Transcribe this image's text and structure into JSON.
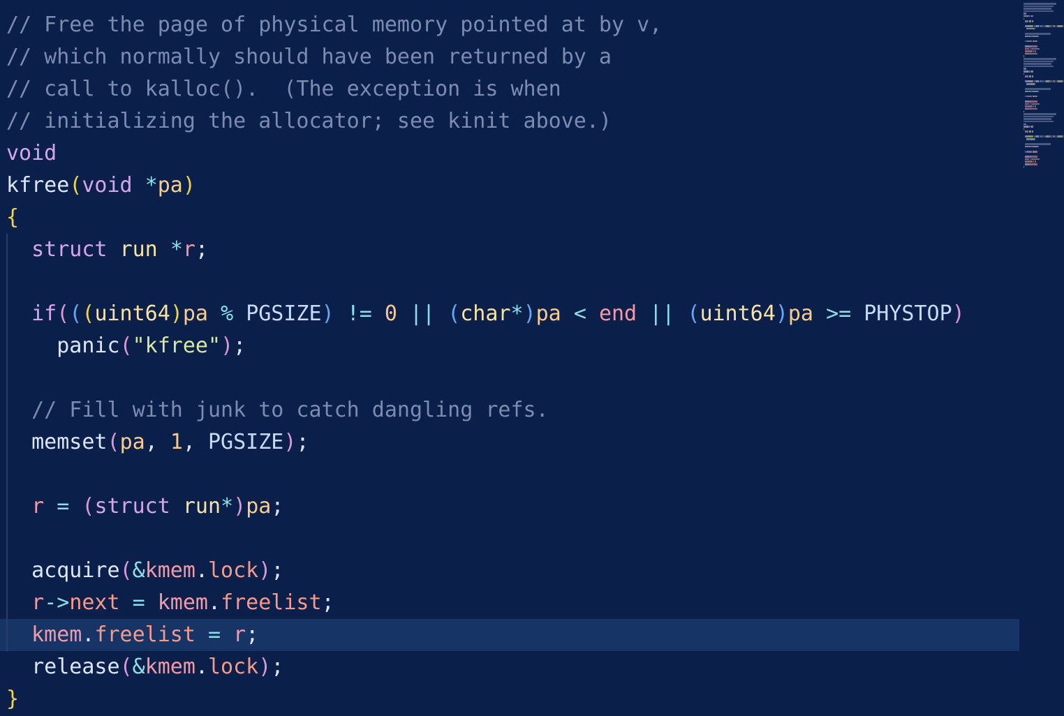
{
  "editor": {
    "language": "c",
    "colors": {
      "background": "#0b1f4b",
      "current_line": "#163466",
      "comment": "#7c8bb0",
      "keyword": "#d4a6ea",
      "string": "#d6e9a3",
      "number": "#f8c98a",
      "variable": "#f39aa8",
      "bracket": "#f3d349"
    },
    "current_line_index": 19,
    "lines": [
      {
        "tokens": [
          {
            "text": "// Free the page of physical memory pointed at by v,",
            "type": "comment"
          }
        ]
      },
      {
        "tokens": [
          {
            "text": "// which normally should have been returned by a",
            "type": "comment"
          }
        ]
      },
      {
        "tokens": [
          {
            "text": "// call to kalloc().  (The exception is when",
            "type": "comment"
          }
        ]
      },
      {
        "tokens": [
          {
            "text": "// initializing the allocator; see kinit above.)",
            "type": "comment"
          }
        ]
      },
      {
        "tokens": [
          {
            "text": "void",
            "type": "keyword"
          }
        ]
      },
      {
        "tokens": [
          {
            "text": "kfree",
            "type": "func"
          },
          {
            "text": "(",
            "type": "brace"
          },
          {
            "text": "void",
            "type": "keyword"
          },
          {
            "text": " ",
            "type": "punct"
          },
          {
            "text": "*",
            "type": "op"
          },
          {
            "text": "pa",
            "type": "param"
          },
          {
            "text": ")",
            "type": "brace"
          }
        ]
      },
      {
        "tokens": [
          {
            "text": "{",
            "type": "brace"
          }
        ]
      },
      {
        "tokens": [
          {
            "text": "  ",
            "type": "punct"
          },
          {
            "text": "struct",
            "type": "keyword"
          },
          {
            "text": " ",
            "type": "punct"
          },
          {
            "text": "run",
            "type": "type"
          },
          {
            "text": " ",
            "type": "punct"
          },
          {
            "text": "*",
            "type": "op"
          },
          {
            "text": "r",
            "type": "var"
          },
          {
            "text": ";",
            "type": "punct"
          }
        ]
      },
      {
        "tokens": []
      },
      {
        "tokens": [
          {
            "text": "  ",
            "type": "punct"
          },
          {
            "text": "if",
            "type": "keyword"
          },
          {
            "text": "(",
            "type": "paren2"
          },
          {
            "text": "(",
            "type": "paren3"
          },
          {
            "text": "(",
            "type": "brace"
          },
          {
            "text": "uint64",
            "type": "type"
          },
          {
            "text": ")",
            "type": "brace"
          },
          {
            "text": "pa",
            "type": "param"
          },
          {
            "text": " ",
            "type": "punct"
          },
          {
            "text": "%",
            "type": "op"
          },
          {
            "text": " ",
            "type": "punct"
          },
          {
            "text": "PGSIZE",
            "type": "const"
          },
          {
            "text": ")",
            "type": "paren3"
          },
          {
            "text": " ",
            "type": "punct"
          },
          {
            "text": "!=",
            "type": "op"
          },
          {
            "text": " ",
            "type": "punct"
          },
          {
            "text": "0",
            "type": "number"
          },
          {
            "text": " ",
            "type": "punct"
          },
          {
            "text": "||",
            "type": "op"
          },
          {
            "text": " ",
            "type": "punct"
          },
          {
            "text": "(",
            "type": "paren3"
          },
          {
            "text": "char",
            "type": "type"
          },
          {
            "text": "*",
            "type": "op"
          },
          {
            "text": ")",
            "type": "paren3"
          },
          {
            "text": "pa",
            "type": "param"
          },
          {
            "text": " ",
            "type": "punct"
          },
          {
            "text": "<",
            "type": "op"
          },
          {
            "text": " ",
            "type": "punct"
          },
          {
            "text": "end",
            "type": "var"
          },
          {
            "text": " ",
            "type": "punct"
          },
          {
            "text": "||",
            "type": "op"
          },
          {
            "text": " ",
            "type": "punct"
          },
          {
            "text": "(",
            "type": "paren3"
          },
          {
            "text": "uint64",
            "type": "type"
          },
          {
            "text": ")",
            "type": "paren3"
          },
          {
            "text": "pa",
            "type": "param"
          },
          {
            "text": " ",
            "type": "punct"
          },
          {
            "text": ">=",
            "type": "op"
          },
          {
            "text": " ",
            "type": "punct"
          },
          {
            "text": "PHYSTOP",
            "type": "const"
          },
          {
            "text": ")",
            "type": "paren2"
          }
        ]
      },
      {
        "tokens": [
          {
            "text": "    ",
            "type": "punct"
          },
          {
            "text": "panic",
            "type": "func"
          },
          {
            "text": "(",
            "type": "paren2"
          },
          {
            "text": "\"kfree\"",
            "type": "string"
          },
          {
            "text": ")",
            "type": "paren2"
          },
          {
            "text": ";",
            "type": "punct"
          }
        ]
      },
      {
        "tokens": []
      },
      {
        "tokens": [
          {
            "text": "  ",
            "type": "punct"
          },
          {
            "text": "// Fill with junk to catch dangling refs.",
            "type": "comment"
          }
        ]
      },
      {
        "tokens": [
          {
            "text": "  ",
            "type": "punct"
          },
          {
            "text": "memset",
            "type": "func"
          },
          {
            "text": "(",
            "type": "paren2"
          },
          {
            "text": "pa",
            "type": "param"
          },
          {
            "text": ", ",
            "type": "punct"
          },
          {
            "text": "1",
            "type": "number"
          },
          {
            "text": ", ",
            "type": "punct"
          },
          {
            "text": "PGSIZE",
            "type": "const"
          },
          {
            "text": ")",
            "type": "paren2"
          },
          {
            "text": ";",
            "type": "punct"
          }
        ]
      },
      {
        "tokens": []
      },
      {
        "tokens": [
          {
            "text": "  ",
            "type": "punct"
          },
          {
            "text": "r",
            "type": "var"
          },
          {
            "text": " ",
            "type": "punct"
          },
          {
            "text": "=",
            "type": "op"
          },
          {
            "text": " ",
            "type": "punct"
          },
          {
            "text": "(",
            "type": "paren2"
          },
          {
            "text": "struct",
            "type": "keyword"
          },
          {
            "text": " ",
            "type": "punct"
          },
          {
            "text": "run",
            "type": "type"
          },
          {
            "text": "*",
            "type": "op"
          },
          {
            "text": ")",
            "type": "paren2"
          },
          {
            "text": "pa",
            "type": "param"
          },
          {
            "text": ";",
            "type": "punct"
          }
        ]
      },
      {
        "tokens": []
      },
      {
        "tokens": [
          {
            "text": "  ",
            "type": "punct"
          },
          {
            "text": "acquire",
            "type": "func"
          },
          {
            "text": "(",
            "type": "paren2"
          },
          {
            "text": "&",
            "type": "op"
          },
          {
            "text": "kmem",
            "type": "var"
          },
          {
            "text": ".",
            "type": "punct"
          },
          {
            "text": "lock",
            "type": "field"
          },
          {
            "text": ")",
            "type": "paren2"
          },
          {
            "text": ";",
            "type": "punct"
          }
        ]
      },
      {
        "tokens": [
          {
            "text": "  ",
            "type": "punct"
          },
          {
            "text": "r",
            "type": "var"
          },
          {
            "text": "->",
            "type": "op"
          },
          {
            "text": "next",
            "type": "field"
          },
          {
            "text": " ",
            "type": "punct"
          },
          {
            "text": "=",
            "type": "op"
          },
          {
            "text": " ",
            "type": "punct"
          },
          {
            "text": "kmem",
            "type": "var"
          },
          {
            "text": ".",
            "type": "punct"
          },
          {
            "text": "freelist",
            "type": "field"
          },
          {
            "text": ";",
            "type": "punct"
          }
        ]
      },
      {
        "tokens": [
          {
            "text": "  ",
            "type": "punct"
          },
          {
            "text": "kmem",
            "type": "var"
          },
          {
            "text": ".",
            "type": "punct"
          },
          {
            "text": "freelist",
            "type": "field"
          },
          {
            "text": " ",
            "type": "punct"
          },
          {
            "text": "=",
            "type": "op"
          },
          {
            "text": " ",
            "type": "punct"
          },
          {
            "text": "r",
            "type": "var"
          },
          {
            "text": ";",
            "type": "punct"
          }
        ]
      },
      {
        "tokens": [
          {
            "text": "  ",
            "type": "punct"
          },
          {
            "text": "release",
            "type": "func"
          },
          {
            "text": "(",
            "type": "paren2"
          },
          {
            "text": "&",
            "type": "op"
          },
          {
            "text": "kmem",
            "type": "var"
          },
          {
            "text": ".",
            "type": "punct"
          },
          {
            "text": "lock",
            "type": "field"
          },
          {
            "text": ")",
            "type": "paren2"
          },
          {
            "text": ";",
            "type": "punct"
          }
        ]
      },
      {
        "tokens": [
          {
            "text": "}",
            "type": "brace"
          }
        ]
      }
    ]
  }
}
